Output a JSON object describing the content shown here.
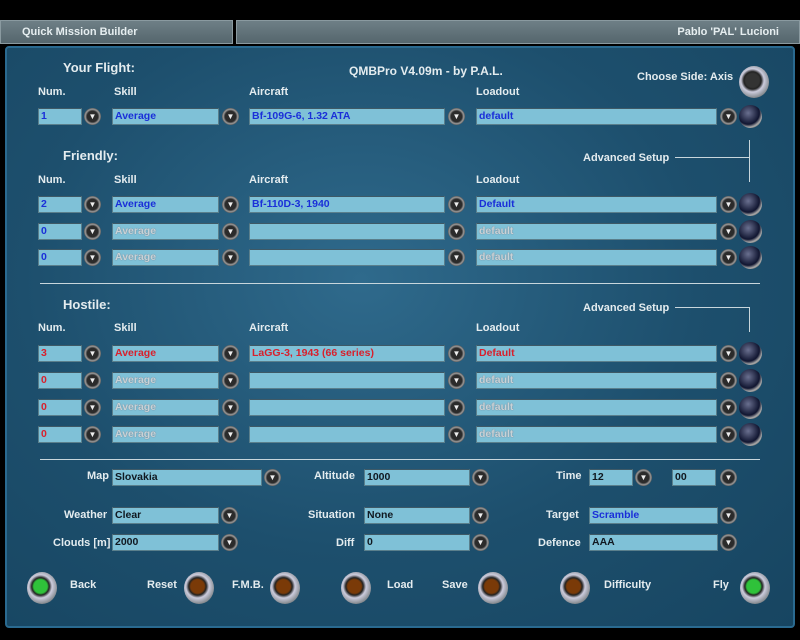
{
  "titlebar": {
    "left": "Quick Mission Builder",
    "right": "Pablo 'PAL' Lucioni"
  },
  "header": {
    "version": "QMBPro V4.09m - by P.A.L.",
    "choose_side": "Choose Side: Axis"
  },
  "columns": {
    "num": "Num.",
    "skill": "Skill",
    "aircraft": "Aircraft",
    "loadout": "Loadout"
  },
  "your_flight": {
    "title": "Your Flight:",
    "rows": [
      {
        "num": "1",
        "skill": "Average",
        "aircraft": "Bf-109G-6, 1.32 ATA",
        "loadout": "default",
        "state": "active"
      }
    ]
  },
  "friendly": {
    "title": "Friendly:",
    "advanced": "Advanced Setup",
    "rows": [
      {
        "num": "2",
        "skill": "Average",
        "aircraft": "Bf-110D-3, 1940",
        "loadout": "Default",
        "state": "active"
      },
      {
        "num": "0",
        "skill": "Average",
        "aircraft": "",
        "loadout": "default",
        "state": "inactive"
      },
      {
        "num": "0",
        "skill": "Average",
        "aircraft": "",
        "loadout": "default",
        "state": "inactive"
      }
    ]
  },
  "hostile": {
    "title": "Hostile:",
    "advanced": "Advanced Setup",
    "rows": [
      {
        "num": "3",
        "skill": "Average",
        "aircraft": "LaGG-3, 1943 (66 series)",
        "loadout": "Default",
        "state": "active"
      },
      {
        "num": "0",
        "skill": "Average",
        "aircraft": "",
        "loadout": "default",
        "state": "inactive"
      },
      {
        "num": "0",
        "skill": "Average",
        "aircraft": "",
        "loadout": "default",
        "state": "inactive"
      },
      {
        "num": "0",
        "skill": "Average",
        "aircraft": "",
        "loadout": "default",
        "state": "inactive"
      }
    ]
  },
  "settings": {
    "map": {
      "label": "Map",
      "value": "Slovakia"
    },
    "altitude": {
      "label": "Altitude",
      "value": "1000"
    },
    "time": {
      "label": "Time",
      "hour": "12",
      "minute": "00"
    },
    "weather": {
      "label": "Weather",
      "value": "Clear"
    },
    "situation": {
      "label": "Situation",
      "value": "None"
    },
    "target": {
      "label": "Target",
      "value": "Scramble"
    },
    "clouds": {
      "label": "Clouds [m]",
      "value": "2000"
    },
    "diff": {
      "label": "Diff",
      "value": "0"
    },
    "defence": {
      "label": "Defence",
      "value": "AAA"
    }
  },
  "buttons": {
    "back": "Back",
    "reset": "Reset",
    "fmb": "F.M.B.",
    "load": "Load",
    "save": "Save",
    "difficulty": "Difficulty",
    "fly": "Fly"
  },
  "colors": {
    "friendly_text": "#1a2fd8",
    "hostile_text": "#d8202c",
    "field_bg": "#7fc1d7"
  }
}
